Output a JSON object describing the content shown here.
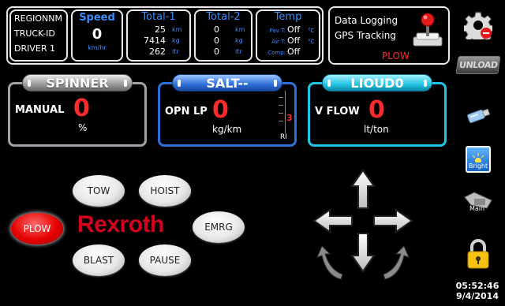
{
  "info": {
    "region": "REGIONNM",
    "truck": "TRUCK-ID",
    "driver": "DRIVER 1"
  },
  "speed": {
    "title": "Speed",
    "value": "0",
    "unit": "km/hr"
  },
  "total1": {
    "title": "Total-1",
    "rows": [
      {
        "v": "25",
        "u": "km"
      },
      {
        "v": "7414",
        "u": "kg"
      },
      {
        "v": "262",
        "u": "ltr"
      }
    ]
  },
  "total2": {
    "title": "Total-2",
    "rows": [
      {
        "v": "0",
        "u": "km"
      },
      {
        "v": "0",
        "u": "kg"
      },
      {
        "v": "0",
        "u": "ltr"
      }
    ]
  },
  "temp": {
    "title": "Temp",
    "rows": [
      {
        "label": "Pav T:",
        "v": "Off",
        "u": "°C"
      },
      {
        "label": "Air T:",
        "v": "Off",
        "u": "°C"
      },
      {
        "label": "Comp:",
        "v": "Off",
        "u": ""
      }
    ]
  },
  "status": {
    "logging": "Data Logging",
    "gps": "GPS Tracking",
    "mode": "PLOW"
  },
  "spinner": {
    "title": "SPINNER",
    "mode": "MANUAL",
    "value": "0",
    "unit": "%"
  },
  "salt": {
    "title": "SALT--",
    "mode": "OPN LP",
    "value": "0",
    "unit": "kg/km",
    "gauge_value": "3",
    "gauge_label": "RI"
  },
  "liquid": {
    "title": "LIOUD0",
    "mode": "V FLOW",
    "value": "0",
    "unit": "lt/ton"
  },
  "buttons": {
    "tow": "TOW",
    "hoist": "HOIST",
    "plow": "PLOW",
    "emrg": "EMRG",
    "blast": "BLAST",
    "pause": "PAUSE"
  },
  "brand": "Rexroth",
  "side": {
    "unload": "UNLOAD",
    "bright": "Bright",
    "main": "Main"
  },
  "clock": {
    "time": "05:52:46",
    "date": "9/4/2014"
  },
  "colors": {
    "accent_blue": "#3a8cff",
    "alert_red": "#ff2a2a",
    "brand_red": "#d4001c"
  }
}
